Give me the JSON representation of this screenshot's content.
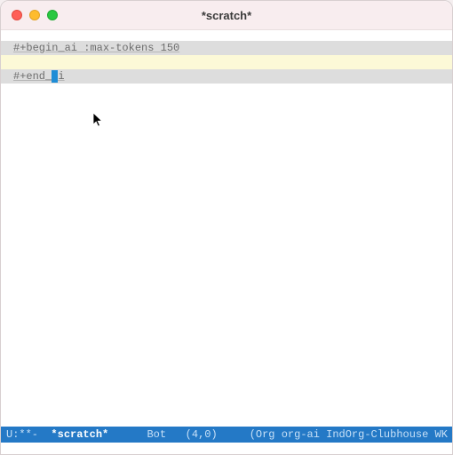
{
  "titlebar": {
    "title": "*scratch*"
  },
  "editor": {
    "begin_delim": "#+begin_ai :max-tokens 150",
    "content_line": "",
    "end_delim": "#+end_ai"
  },
  "modeline": {
    "status": "U:**-",
    "buffer": "*scratch*",
    "position": "Bot",
    "coords": "(4,0)",
    "modes": "(Org org-ai IndOrg-Clubhouse WK"
  }
}
